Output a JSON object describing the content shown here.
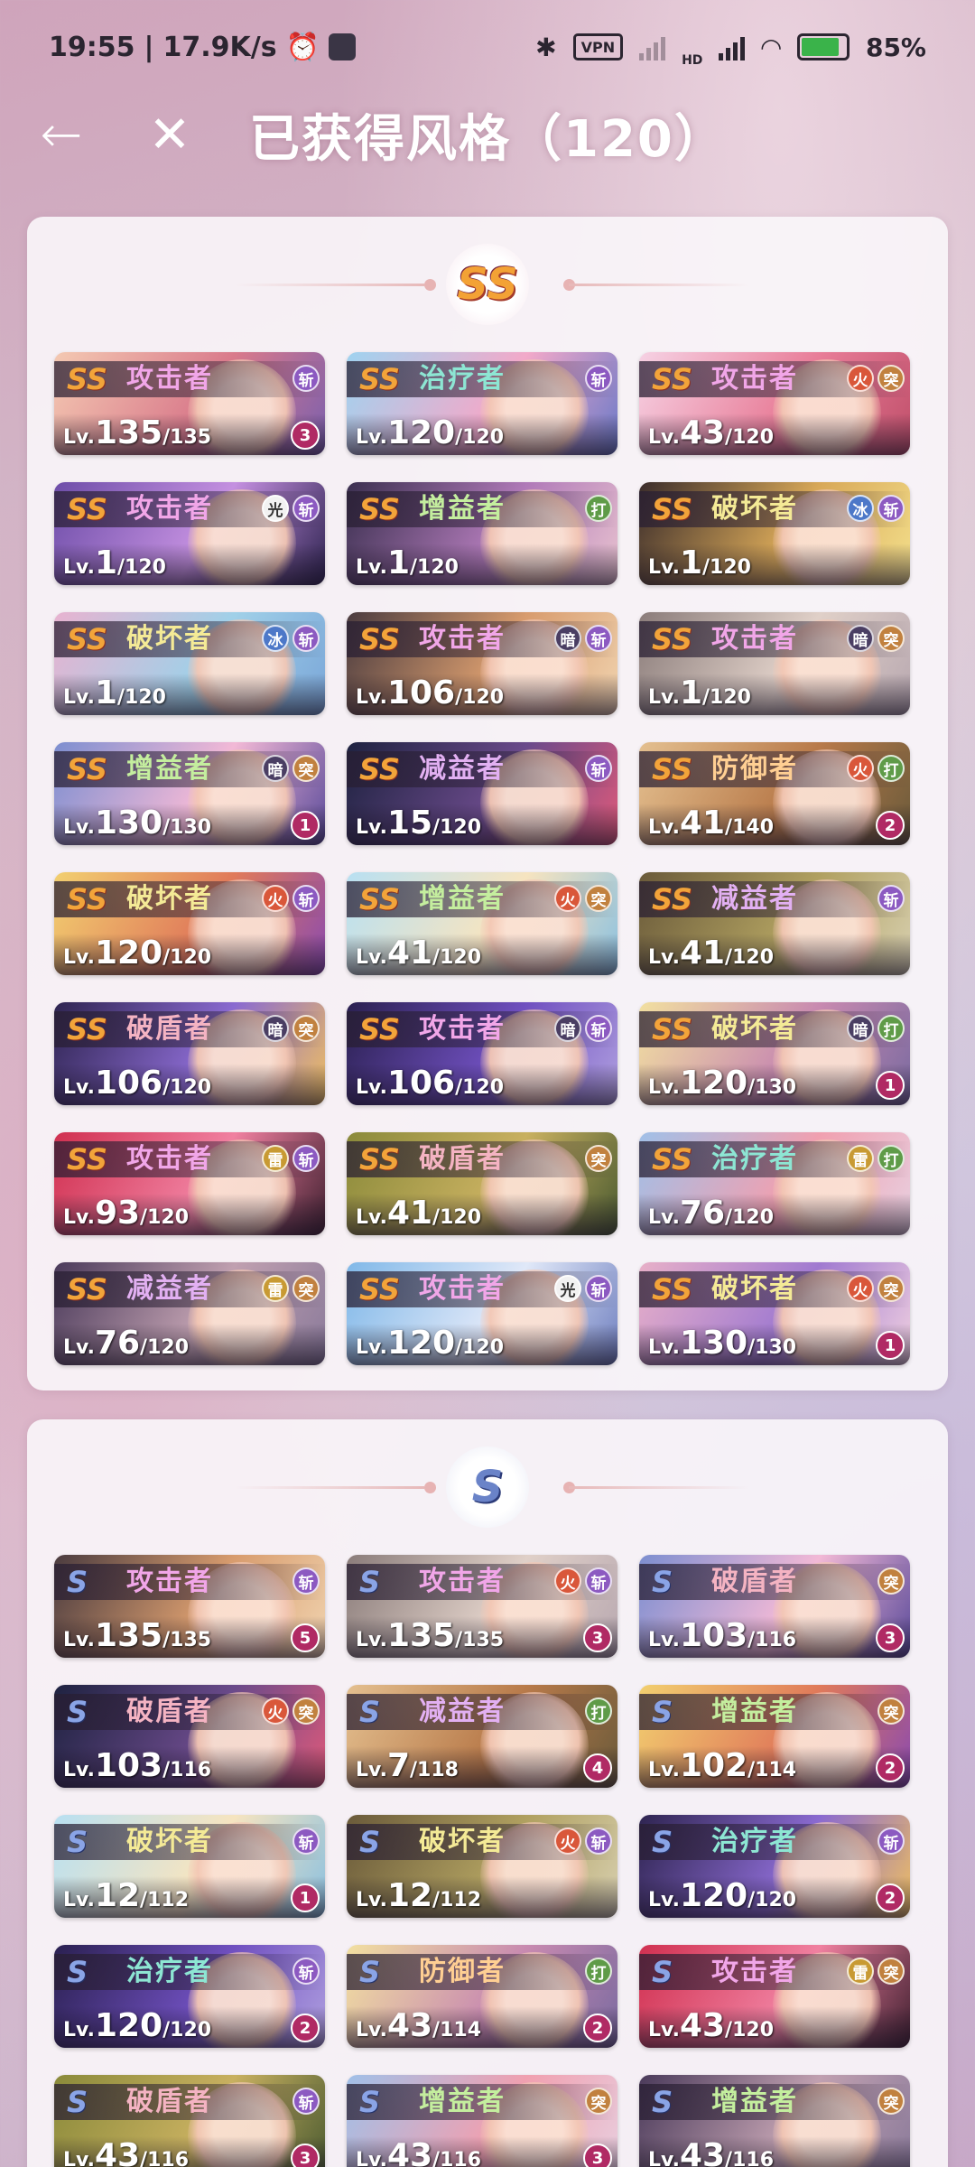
{
  "status_bar": {
    "time": "19:55",
    "net_speed": "17.9K/s",
    "vpn": "VPN",
    "hd": "HD",
    "battery": "85%",
    "battery_level": 0.85
  },
  "header": {
    "back_icon": "arrow-left-icon",
    "close_icon": "close-icon",
    "title": "已获得风格（120）"
  },
  "tag_colors": {
    "斩": "#8c5ac1",
    "打": "#5f9b48",
    "突": "#c1813f",
    "火": "#d9573a",
    "冰": "#4d78c8",
    "光": "#f2f2f2",
    "暗": "#4a3e63",
    "雷": "#c89a33"
  },
  "sections": [
    {
      "rank": "SS",
      "cards": [
        {
          "role": "攻击者",
          "tags": [
            "斩"
          ],
          "lv": "135",
          "max": "135",
          "star": "3"
        },
        {
          "role": "治疗者",
          "tags": [
            "斩"
          ],
          "lv": "120",
          "max": "120",
          "star": ""
        },
        {
          "role": "攻击者",
          "tags": [
            "火",
            "突"
          ],
          "lv": "43",
          "max": "120",
          "star": ""
        },
        {
          "role": "攻击者",
          "tags": [
            "光",
            "斩"
          ],
          "lv": "1",
          "max": "120",
          "star": ""
        },
        {
          "role": "增益者",
          "tags": [
            "打"
          ],
          "lv": "1",
          "max": "120",
          "star": ""
        },
        {
          "role": "破坏者",
          "tags": [
            "冰",
            "斩"
          ],
          "lv": "1",
          "max": "120",
          "star": ""
        },
        {
          "role": "破坏者",
          "tags": [
            "冰",
            "斩"
          ],
          "lv": "1",
          "max": "120",
          "star": ""
        },
        {
          "role": "攻击者",
          "tags": [
            "暗",
            "斩"
          ],
          "lv": "106",
          "max": "120",
          "star": ""
        },
        {
          "role": "攻击者",
          "tags": [
            "暗",
            "突"
          ],
          "lv": "1",
          "max": "120",
          "star": ""
        },
        {
          "role": "增益者",
          "tags": [
            "暗",
            "突"
          ],
          "lv": "130",
          "max": "130",
          "star": "1"
        },
        {
          "role": "减益者",
          "tags": [
            "斩"
          ],
          "lv": "15",
          "max": "120",
          "star": ""
        },
        {
          "role": "防御者",
          "tags": [
            "火",
            "打"
          ],
          "lv": "41",
          "max": "140",
          "star": "2"
        },
        {
          "role": "破坏者",
          "tags": [
            "火",
            "斩"
          ],
          "lv": "120",
          "max": "120",
          "star": ""
        },
        {
          "role": "增益者",
          "tags": [
            "火",
            "突"
          ],
          "lv": "41",
          "max": "120",
          "star": ""
        },
        {
          "role": "减益者",
          "tags": [
            "斩"
          ],
          "lv": "41",
          "max": "120",
          "star": ""
        },
        {
          "role": "破盾者",
          "tags": [
            "暗",
            "突"
          ],
          "lv": "106",
          "max": "120",
          "star": ""
        },
        {
          "role": "攻击者",
          "tags": [
            "暗",
            "斩"
          ],
          "lv": "106",
          "max": "120",
          "star": ""
        },
        {
          "role": "破坏者",
          "tags": [
            "暗",
            "打"
          ],
          "lv": "120",
          "max": "130",
          "star": "1"
        },
        {
          "role": "攻击者",
          "tags": [
            "雷",
            "斩"
          ],
          "lv": "93",
          "max": "120",
          "star": ""
        },
        {
          "role": "破盾者",
          "tags": [
            "突"
          ],
          "lv": "41",
          "max": "120",
          "star": ""
        },
        {
          "role": "治疗者",
          "tags": [
            "雷",
            "打"
          ],
          "lv": "76",
          "max": "120",
          "star": ""
        },
        {
          "role": "减益者",
          "tags": [
            "雷",
            "突"
          ],
          "lv": "76",
          "max": "120",
          "star": ""
        },
        {
          "role": "攻击者",
          "tags": [
            "光",
            "斩"
          ],
          "lv": "120",
          "max": "120",
          "star": ""
        },
        {
          "role": "破坏者",
          "tags": [
            "火",
            "突"
          ],
          "lv": "130",
          "max": "130",
          "star": "1"
        }
      ]
    },
    {
      "rank": "S",
      "cards": [
        {
          "role": "攻击者",
          "tags": [
            "斩"
          ],
          "lv": "135",
          "max": "135",
          "star": "5"
        },
        {
          "role": "攻击者",
          "tags": [
            "火",
            "斩"
          ],
          "lv": "135",
          "max": "135",
          "star": "3"
        },
        {
          "role": "破盾者",
          "tags": [
            "突"
          ],
          "lv": "103",
          "max": "116",
          "star": "3"
        },
        {
          "role": "破盾者",
          "tags": [
            "火",
            "突"
          ],
          "lv": "103",
          "max": "116",
          "star": ""
        },
        {
          "role": "减益者",
          "tags": [
            "打"
          ],
          "lv": "7",
          "max": "118",
          "star": "4"
        },
        {
          "role": "增益者",
          "tags": [
            "突"
          ],
          "lv": "102",
          "max": "114",
          "star": "2"
        },
        {
          "role": "破坏者",
          "tags": [
            "斩"
          ],
          "lv": "12",
          "max": "112",
          "star": "1"
        },
        {
          "role": "破坏者",
          "tags": [
            "火",
            "斩"
          ],
          "lv": "12",
          "max": "112",
          "star": ""
        },
        {
          "role": "治疗者",
          "tags": [
            "斩"
          ],
          "lv": "120",
          "max": "120",
          "star": "2"
        },
        {
          "role": "治疗者",
          "tags": [
            "斩"
          ],
          "lv": "120",
          "max": "120",
          "star": "2"
        },
        {
          "role": "防御者",
          "tags": [
            "打"
          ],
          "lv": "43",
          "max": "114",
          "star": "2"
        },
        {
          "role": "攻击者",
          "tags": [
            "雷",
            "突"
          ],
          "lv": "43",
          "max": "120",
          "star": ""
        },
        {
          "role": "破盾者",
          "tags": [
            "斩"
          ],
          "lv": "43",
          "max": "116",
          "star": "3"
        },
        {
          "role": "增益者",
          "tags": [
            "突"
          ],
          "lv": "43",
          "max": "116",
          "star": "3"
        },
        {
          "role": "增益者",
          "tags": [
            "突"
          ],
          "lv": "43",
          "max": "116",
          "star": ""
        }
      ]
    }
  ]
}
